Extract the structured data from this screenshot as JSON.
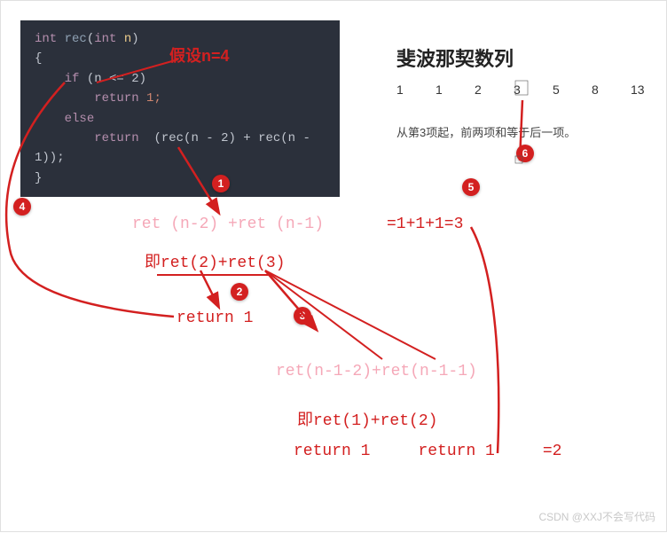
{
  "code": {
    "line1_type": "int",
    "line1_fn": "rec",
    "line1_paramtype": "int",
    "line1_param": "n",
    "line2": "{",
    "line3_if": "if",
    "line3_cond": "(n <= 2)",
    "line4_ret": "return",
    "line4_val": "1;",
    "line5_else": "else",
    "line6_ret": "return",
    "line6_expr": "(rec(n - 2) + rec(n - 1));",
    "line7": "}"
  },
  "assume": "假设n=4",
  "title": "斐波那契数列",
  "fib": [
    "1",
    "1",
    "2",
    "3",
    "5",
    "8",
    "13"
  ],
  "desc": "从第3项起，前两项和等于后一项。",
  "badges": {
    "b1": "1",
    "b2": "2",
    "b3": "3",
    "b4": "4",
    "b5": "5",
    "b6": "6"
  },
  "exp1": "ret (n-2) +ret (n-1)",
  "exp1_eq": "=1+1+1=3",
  "exp2": "即ret(2)+ret(3)",
  "ret1": "return 1",
  "exp3": "ret(n-1-2)+ret(n-1-1)",
  "exp4": "即ret(1)+ret(2)",
  "ret_row_a": "return 1",
  "ret_row_b": "return 1",
  "ret_row_eq": "=2",
  "watermark": "CSDN @XXJ不会写代码"
}
